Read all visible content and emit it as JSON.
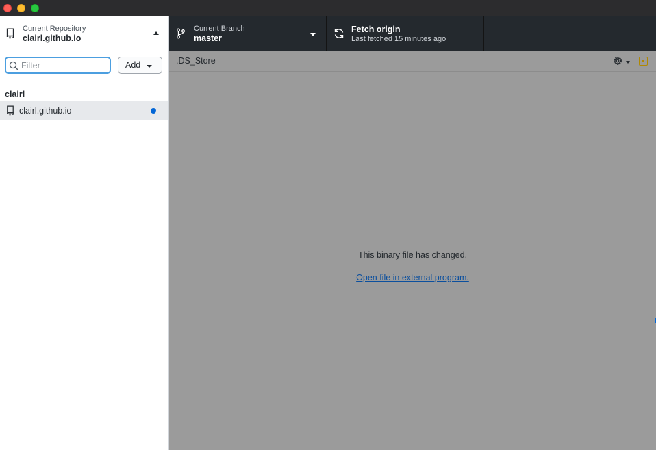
{
  "window": {
    "traffic_lights": [
      "close",
      "minimize",
      "zoom"
    ]
  },
  "sidebar": {
    "repo_header": {
      "label": "Current Repository",
      "value": "clairl.github.io"
    },
    "filter": {
      "placeholder": "Filter",
      "value": ""
    },
    "add_button": "Add",
    "groups": [
      {
        "title": "clairl",
        "repos": [
          {
            "name": "clairl.github.io",
            "selected": true,
            "has_changes": true
          }
        ]
      }
    ]
  },
  "toolbar": {
    "branch": {
      "label": "Current Branch",
      "value": "master"
    },
    "fetch": {
      "label": "Fetch origin",
      "value": "Last fetched 15 minutes ago"
    }
  },
  "diff": {
    "file_name": ".DS_Store",
    "message": "This binary file has changed.",
    "link": "Open file in external program."
  },
  "colors": {
    "toolbar_bg": "#24292e",
    "diff_bg": "#9b9b9b",
    "accent": "#0366d6",
    "link": "#0b4f9e"
  }
}
